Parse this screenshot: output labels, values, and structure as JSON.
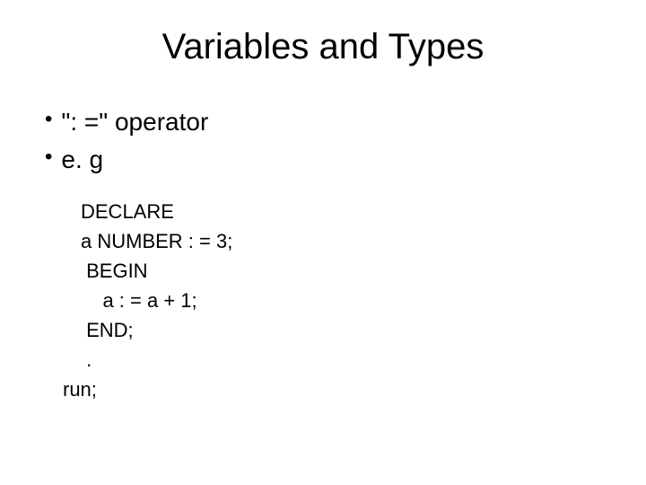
{
  "title": "Variables and Types",
  "bullets": [
    "\": =\" operator",
    "e. g"
  ],
  "code": {
    "line0": "DECLARE",
    "line1": "a NUMBER : = 3;",
    "line2": " BEGIN",
    "line3": "    a : = a + 1;",
    "line4": " END;",
    "line5": " .",
    "line6": "run;"
  }
}
